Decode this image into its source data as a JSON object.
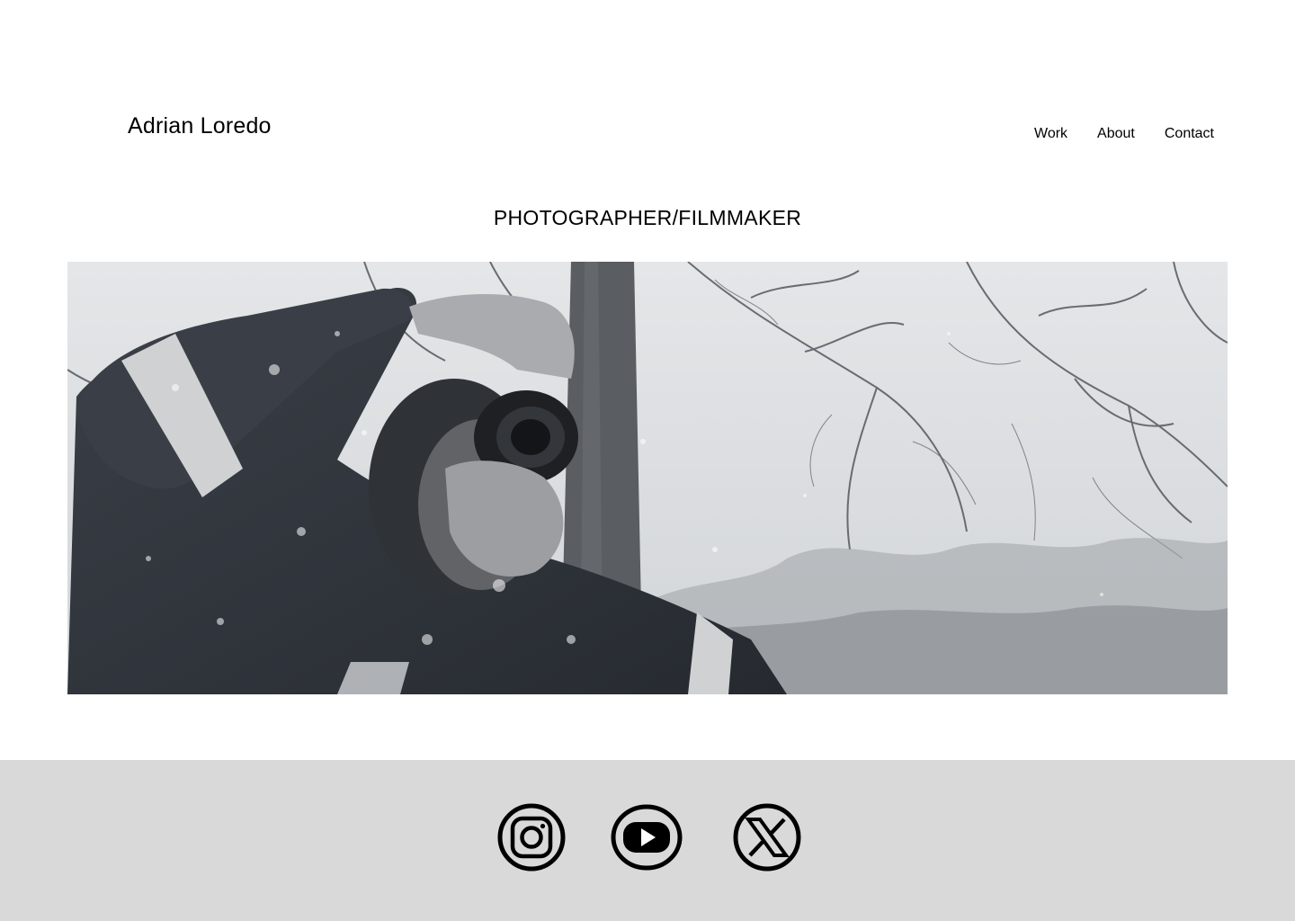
{
  "header": {
    "brand": "Adrian Loredo",
    "nav": [
      "Work",
      "About",
      "Contact"
    ]
  },
  "hero": {
    "tagline": "PHOTOGRAPHER/FILMMAKER"
  },
  "footer": {
    "social_icons": [
      "instagram-icon",
      "youtube-icon",
      "x-icon"
    ]
  },
  "colors": {
    "background": "#ffffff",
    "footer_background": "#d9d9d9",
    "text": "#000000"
  }
}
